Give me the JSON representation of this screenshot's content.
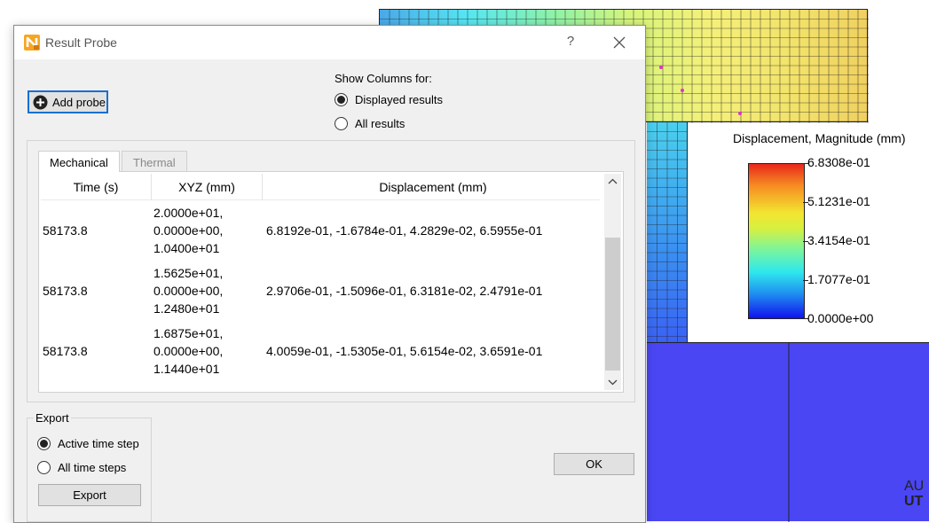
{
  "dialog": {
    "title": "Result Probe",
    "help_label": "?",
    "add_probe_label": "Add probe",
    "show_columns_label": "Show Columns for:",
    "columns_options": [
      {
        "label": "Displayed results",
        "selected": true
      },
      {
        "label": "All results",
        "selected": false
      }
    ],
    "tabs": [
      {
        "label": "Mechanical",
        "active": true
      },
      {
        "label": "Thermal",
        "active": false
      }
    ],
    "table": {
      "headers": [
        "Time (s)",
        "XYZ (mm)",
        "Displacement (mm)"
      ],
      "rows": [
        {
          "time": "58173.8",
          "xyz": [
            "2.0000e+01,",
            "0.0000e+00,",
            "1.0400e+01"
          ],
          "displacement": "6.8192e-01, -1.6784e-01, 4.2829e-02, 6.5955e-01"
        },
        {
          "time": "58173.8",
          "xyz": [
            "1.5625e+01,",
            "0.0000e+00,",
            "1.2480e+01"
          ],
          "displacement": "2.9706e-01, -1.5096e-01, 6.3181e-02, 2.4791e-01"
        },
        {
          "time": "58173.8",
          "xyz": [
            "1.6875e+01,",
            "0.0000e+00,",
            "1.1440e+01"
          ],
          "displacement": "4.0059e-01, -1.5305e-01, 5.6154e-02, 3.6591e-01"
        }
      ]
    },
    "export": {
      "group_label": "Export",
      "options": [
        {
          "label": "Active time step",
          "selected": true
        },
        {
          "label": "All time steps",
          "selected": false
        }
      ],
      "button_label": "Export"
    },
    "ok_label": "OK"
  },
  "legend": {
    "title": "Displacement, Magnitude (mm)",
    "labels": [
      "6.8308e-01",
      "5.1231e-01",
      "3.4154e-01",
      "1.7077e-01",
      "0.0000e+00"
    ]
  },
  "brand": {
    "line1": "AU",
    "line2": "UT"
  },
  "colors": {
    "accent": "#1a6fd0",
    "dialog_bg": "#f0f0f0",
    "mesh_bottom": "#4a46f4"
  }
}
